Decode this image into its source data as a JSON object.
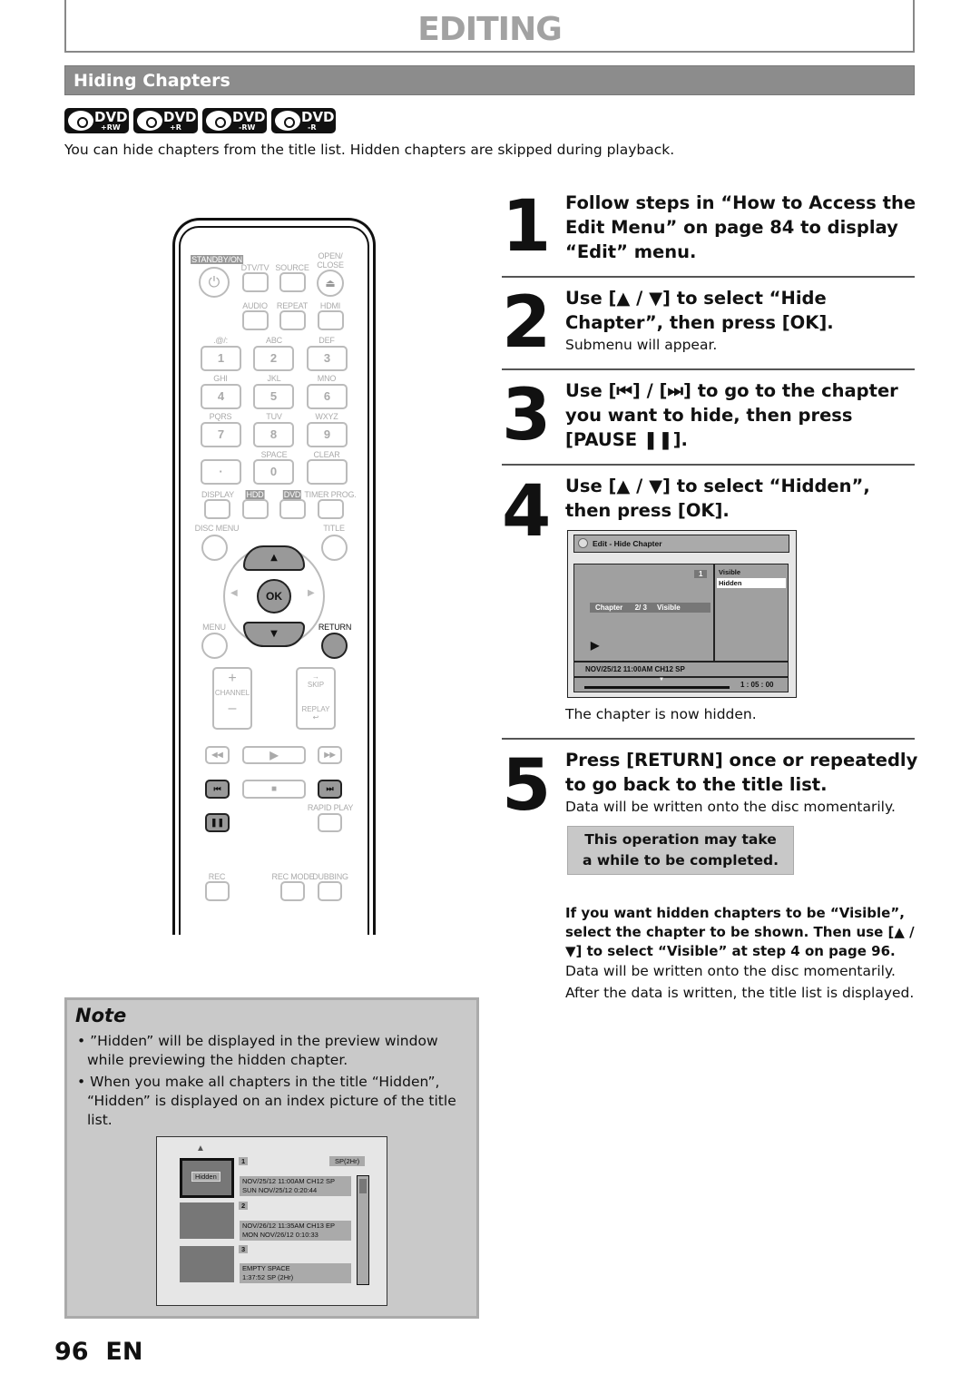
{
  "header": {
    "section": "EDITING",
    "subsection": "Hiding Chapters"
  },
  "disc_logos": [
    {
      "label": "DVD",
      "sub": "+RW"
    },
    {
      "label": "DVD",
      "sub": "+R"
    },
    {
      "label": "DVD",
      "sub": "-RW"
    },
    {
      "label": "DVD",
      "sub": "-R"
    }
  ],
  "intro": "You can hide chapters from the title list. Hidden chapters are skipped during playback.",
  "steps": [
    {
      "num": "1",
      "head": "Follow steps in “How to Access the Edit Menu” on page 84 to display “Edit” menu."
    },
    {
      "num": "2",
      "head": "Use [▲ / ▼] to select “Hide Chapter”, then press [OK].",
      "sub": "Submenu will appear."
    },
    {
      "num": "3",
      "head": "Use [⏮] / [⏭] to go to the chapter you want to hide, then press [PAUSE ❚❚]."
    },
    {
      "num": "4",
      "head": "Use [▲ / ▼] to select “Hidden”, then press [OK].",
      "sub": "The chapter is now hidden."
    },
    {
      "num": "5",
      "head": "Press [RETURN] once or repeatedly to go back to the title list.",
      "sub": "Data will be written onto the disc momentarily."
    }
  ],
  "notice": "This operation may take a while to be completed.",
  "visible_tip": {
    "bold": "If you want hidden chapters to be “Visible”, select the chapter to be shown. Then use [▲ / ▼] to select “Visible” at step 4 on page 96.",
    "line1": "Data will be written onto the disc momentarily.",
    "line2": "After the data is written, the title list is displayed."
  },
  "osd": {
    "title": "Edit - Hide Chapter",
    "chapter_num": "1",
    "chapter_label": "Chapter",
    "chapter_pos": "2/ 3",
    "chapter_state": "Visible",
    "options": [
      "Visible",
      "Hidden"
    ],
    "selected": "Hidden",
    "info": "NOV/25/12 11:00AM CH12 SP",
    "time": "1 : 05 : 00"
  },
  "note": {
    "title": "Note",
    "bullets": [
      "”Hidden” will be displayed in the preview window while previewing the hidden chapter.",
      "When you make all chapters in the title “Hidden”, “Hidden” is displayed on an index picture of the title list."
    ]
  },
  "title_list": {
    "mode": "SP(2Hr)",
    "hidden_label": "Hidden",
    "items": [
      {
        "num": "1",
        "line1": "NOV/25/12  11:00AM CH12  SP",
        "line2": "SUN NOV/25/12    0:20:44"
      },
      {
        "num": "2",
        "line1": "NOV/26/12  11:35AM CH13  EP",
        "line2": "MON NOV/26/12    0:10:33"
      },
      {
        "num": "3",
        "line1": "EMPTY SPACE",
        "line2": "1:37:52  SP (2Hr)"
      }
    ]
  },
  "remote": {
    "standby": "STANDBY/ON",
    "dtvtv": "DTV/TV",
    "source": "SOURCE",
    "open": "OPEN/",
    "close": "CLOSE",
    "audio": "AUDIO",
    "repeat": "REPEAT",
    "hdmi": "HDMI",
    "keys": [
      {
        "l": ".@/:",
        "n": "1"
      },
      {
        "l": "ABC",
        "n": "2"
      },
      {
        "l": "DEF",
        "n": "3"
      },
      {
        "l": "GHI",
        "n": "4"
      },
      {
        "l": "JKL",
        "n": "5"
      },
      {
        "l": "MNO",
        "n": "6"
      },
      {
        "l": "PQRS",
        "n": "7"
      },
      {
        "l": "TUV",
        "n": "8"
      },
      {
        "l": "WXYZ",
        "n": "9"
      }
    ],
    "dot": "·",
    "zero": "0",
    "space": "SPACE",
    "clear": "CLEAR",
    "display": "DISPLAY",
    "hdd": "HDD",
    "dvd": "DVD",
    "timer": "TIMER PROG.",
    "discmenu": "DISC MENU",
    "title": "TITLE",
    "ok": "OK",
    "menu": "MENU",
    "ret": "RETURN",
    "plus": "+",
    "channel": "CHANNEL",
    "minus": "–",
    "skip": "SKIP",
    "replay": "REPLAY",
    "rapid": "RAPID PLAY",
    "rec": "REC",
    "recmode": "REC MODE",
    "dubbing": "DUBBING"
  },
  "footer": {
    "page": "96",
    "lang": "EN"
  }
}
